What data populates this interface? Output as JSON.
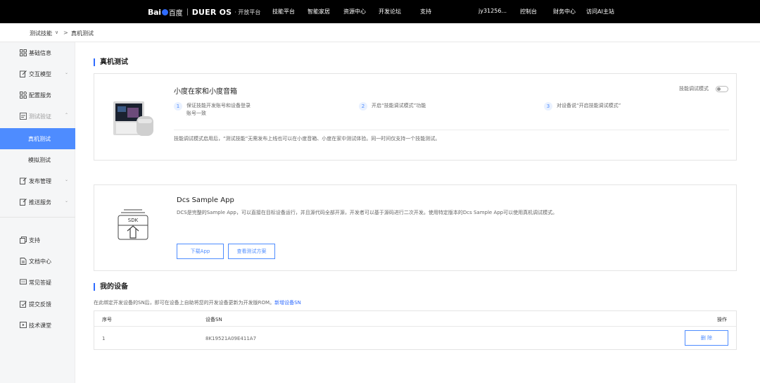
{
  "topbar": {
    "brand_bai": "Bai",
    "brand_du": "百度",
    "brand_dueros": "DUER OS",
    "brand_platform": "· 开放平台",
    "nav": [
      "技能平台",
      "智能家居",
      "资源中心",
      "开发论坛",
      "支持"
    ],
    "user": "jy31256...",
    "right_links": [
      "控制台",
      "财务中心",
      "访问AI主站"
    ]
  },
  "breadcrumb": {
    "parent": "测试技能",
    "current": "真机测试"
  },
  "sidebar": {
    "items": [
      {
        "label": "基础信息",
        "icon": "grid-icon"
      },
      {
        "label": "交互模型",
        "icon": "edit-icon",
        "arrow": "⌄"
      },
      {
        "label": "配置服务",
        "icon": "settings-grid-icon"
      },
      {
        "label": "测试验证",
        "icon": "test-icon",
        "arrow": "⌃"
      },
      {
        "label": "真机测试"
      },
      {
        "label": "模拟测试"
      },
      {
        "label": "发布管理",
        "icon": "publish-icon",
        "arrow": "⌄"
      },
      {
        "label": "推送服务",
        "icon": "push-icon",
        "arrow": "⌄"
      },
      {
        "label": "支持",
        "icon": "copy-icon"
      },
      {
        "label": "文档中心",
        "icon": "doc-icon"
      },
      {
        "label": "常见答疑",
        "icon": "chat-icon"
      },
      {
        "label": "提交反馈",
        "icon": "feedback-icon"
      },
      {
        "label": "技术课堂",
        "icon": "class-icon"
      }
    ]
  },
  "main": {
    "title": "真机测试",
    "device_card": {
      "heading": "小度在家和小度音箱",
      "toggle_label": "技能调试模式",
      "steps": [
        {
          "num": "1",
          "text": "保证技能开发账号和设备登录账号一致"
        },
        {
          "num": "2",
          "text": "开启“技能调试模式”功能"
        },
        {
          "num": "3",
          "text": "对设备说“开启技能调试模式”"
        }
      ],
      "note": "技能调试模式启用后，“测试技能”无需发布上线也可以在小度音箱、小度在家中测试体验。同一时间仅支持一个技能测试。"
    },
    "sdk_card": {
      "sdk_label": "SDK",
      "heading": "Dcs Sample App",
      "desc": "DCS是完整的Sample App，可以直接在目标设备运行，并且源代码全部开源，开发者可以基于源码进行二次开发。使用特定版本的Dcs Sample App可以使用真机调试模式。",
      "download_btn": "下载App",
      "plan_btn": "查看测试方案"
    },
    "devices": {
      "title": "我的设备",
      "desc": "在此绑定开发设备的SN后，即可在设备上自助将您的开发设备更新为开发版ROM。",
      "add_link": "新增设备SN",
      "columns": [
        "序号",
        "设备SN",
        "操作"
      ],
      "rows": [
        {
          "index": "1",
          "sn": "8K19521A09E411A7",
          "action": "删 除"
        }
      ]
    }
  }
}
